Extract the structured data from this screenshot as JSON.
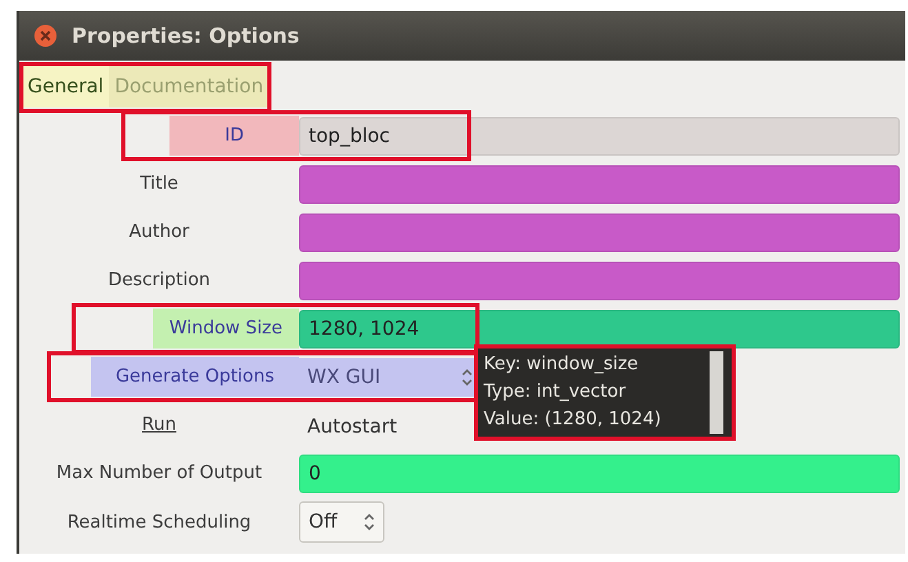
{
  "window": {
    "title": "Properties: Options"
  },
  "tabs": [
    {
      "label": "General",
      "selected": true
    },
    {
      "label": "Documentation",
      "selected": false
    }
  ],
  "tabs_highlighted": true,
  "rows": [
    {
      "label": {
        "text": "ID",
        "color": "#f2b8bc"
      },
      "kind": "text",
      "value": "top_bloc",
      "color": "#dcd6d4",
      "highlighted": true
    },
    {
      "label": {
        "text": "Title"
      },
      "kind": "text",
      "color": "#c85ac8",
      "highlighted": false
    },
    {
      "label": {
        "text": "Author"
      },
      "kind": "text",
      "color": "#c85ac8",
      "highlighted": false
    },
    {
      "label": {
        "text": "Description"
      },
      "kind": "text",
      "color": "#c85ac8",
      "highlighted": false
    },
    {
      "label": {
        "text": "Window Size",
        "color": "#c4f0b0"
      },
      "kind": "text",
      "value": "1280, 1024",
      "color": "#2ec88c",
      "highlighted": true
    },
    {
      "label": {
        "text": "Generate Options",
        "color": "#c4c4f0"
      },
      "kind": "combo",
      "value": "WX GUI",
      "color": "#c4c4f0",
      "highlighted": true
    },
    {
      "label": {
        "text": "Run"
      },
      "kind": "plain",
      "value": "Autostart",
      "highlighted": false
    },
    {
      "label": {
        "text": "Max Number of Output"
      },
      "kind": "text",
      "value": "0",
      "color": "#34f08c",
      "highlighted": false
    },
    {
      "label": {
        "text": "Realtime Scheduling"
      },
      "kind": "spin",
      "value": "Off",
      "highlighted": false
    }
  ],
  "tooltip": {
    "lines": [
      "Key: window_size",
      "Type: int_vector",
      "Value: (1280, 1024)"
    ],
    "highlighted": true
  }
}
